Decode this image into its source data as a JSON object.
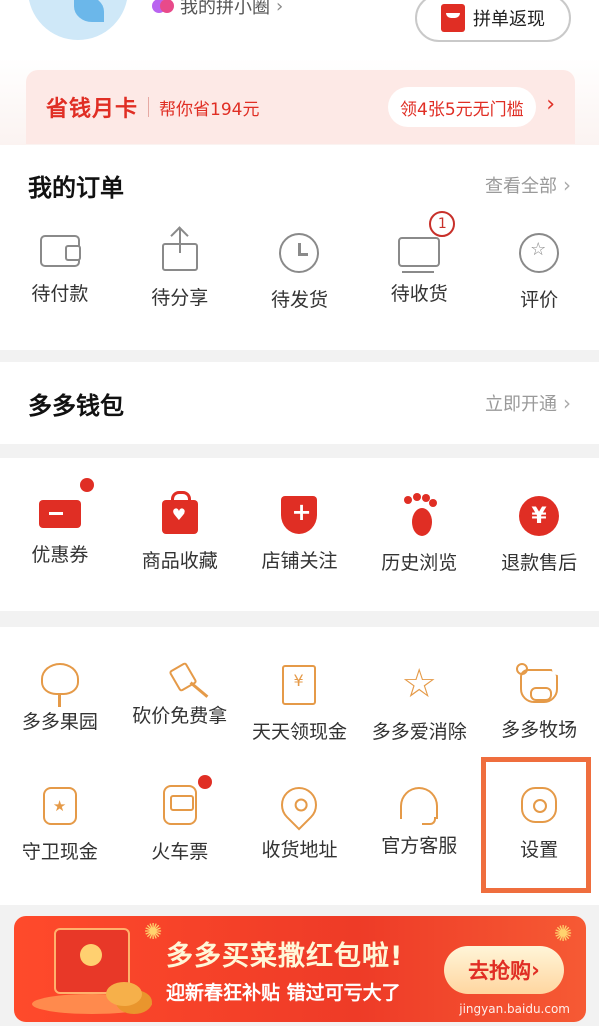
{
  "profile": {
    "circle_label": "我的拼小圈",
    "cashback_label": "拼单返现"
  },
  "savecard": {
    "title": "省钱月卡",
    "subtitle": "帮你省194元",
    "coupon": "领4张5元无门槛",
    "arrow": "›"
  },
  "orders": {
    "title": "我的订单",
    "more": "查看全部",
    "items": [
      {
        "label": "待付款",
        "icon": "wallet-icon"
      },
      {
        "label": "待分享",
        "icon": "share-icon"
      },
      {
        "label": "待发货",
        "icon": "clock-icon"
      },
      {
        "label": "待收货",
        "icon": "truck-icon",
        "badge": "1"
      },
      {
        "label": "评价",
        "icon": "review-star-icon"
      }
    ]
  },
  "wallet": {
    "title": "多多钱包",
    "more": "立即开通"
  },
  "favorites": {
    "items": [
      {
        "label": "优惠券",
        "icon": "coupon-icon",
        "dot": true
      },
      {
        "label": "商品收藏",
        "icon": "bag-heart-icon"
      },
      {
        "label": "店铺关注",
        "icon": "shop-plus-icon"
      },
      {
        "label": "历史浏览",
        "icon": "footprint-icon"
      },
      {
        "label": "退款售后",
        "icon": "yen-icon",
        "symbol": "¥"
      }
    ]
  },
  "games": {
    "row1": [
      {
        "label": "多多果园",
        "icon": "tree-icon"
      },
      {
        "label": "砍价免费拿",
        "icon": "axe-icon"
      },
      {
        "label": "天天领现金",
        "icon": "cash-icon"
      },
      {
        "label": "多多爱消除",
        "icon": "star-wand-icon"
      },
      {
        "label": "多多牧场",
        "icon": "cow-icon"
      }
    ],
    "row2": [
      {
        "label": "守卫现金",
        "icon": "jar-icon"
      },
      {
        "label": "火车票",
        "icon": "train-icon",
        "dot": true
      },
      {
        "label": "收货地址",
        "icon": "location-pin-icon"
      },
      {
        "label": "官方客服",
        "icon": "headset-icon"
      },
      {
        "label": "设置",
        "icon": "gear-icon"
      }
    ]
  },
  "banner": {
    "title": "多多买菜撒红包啦!",
    "subtitle": "迎新春狂补贴 错过可亏大了",
    "cta": "去抢购",
    "watermark": "jingyan.baidu.com"
  },
  "colors": {
    "brand_red": "#e02e24",
    "icon_orange": "#e59a48",
    "highlight_box": "#ef6e3e"
  }
}
